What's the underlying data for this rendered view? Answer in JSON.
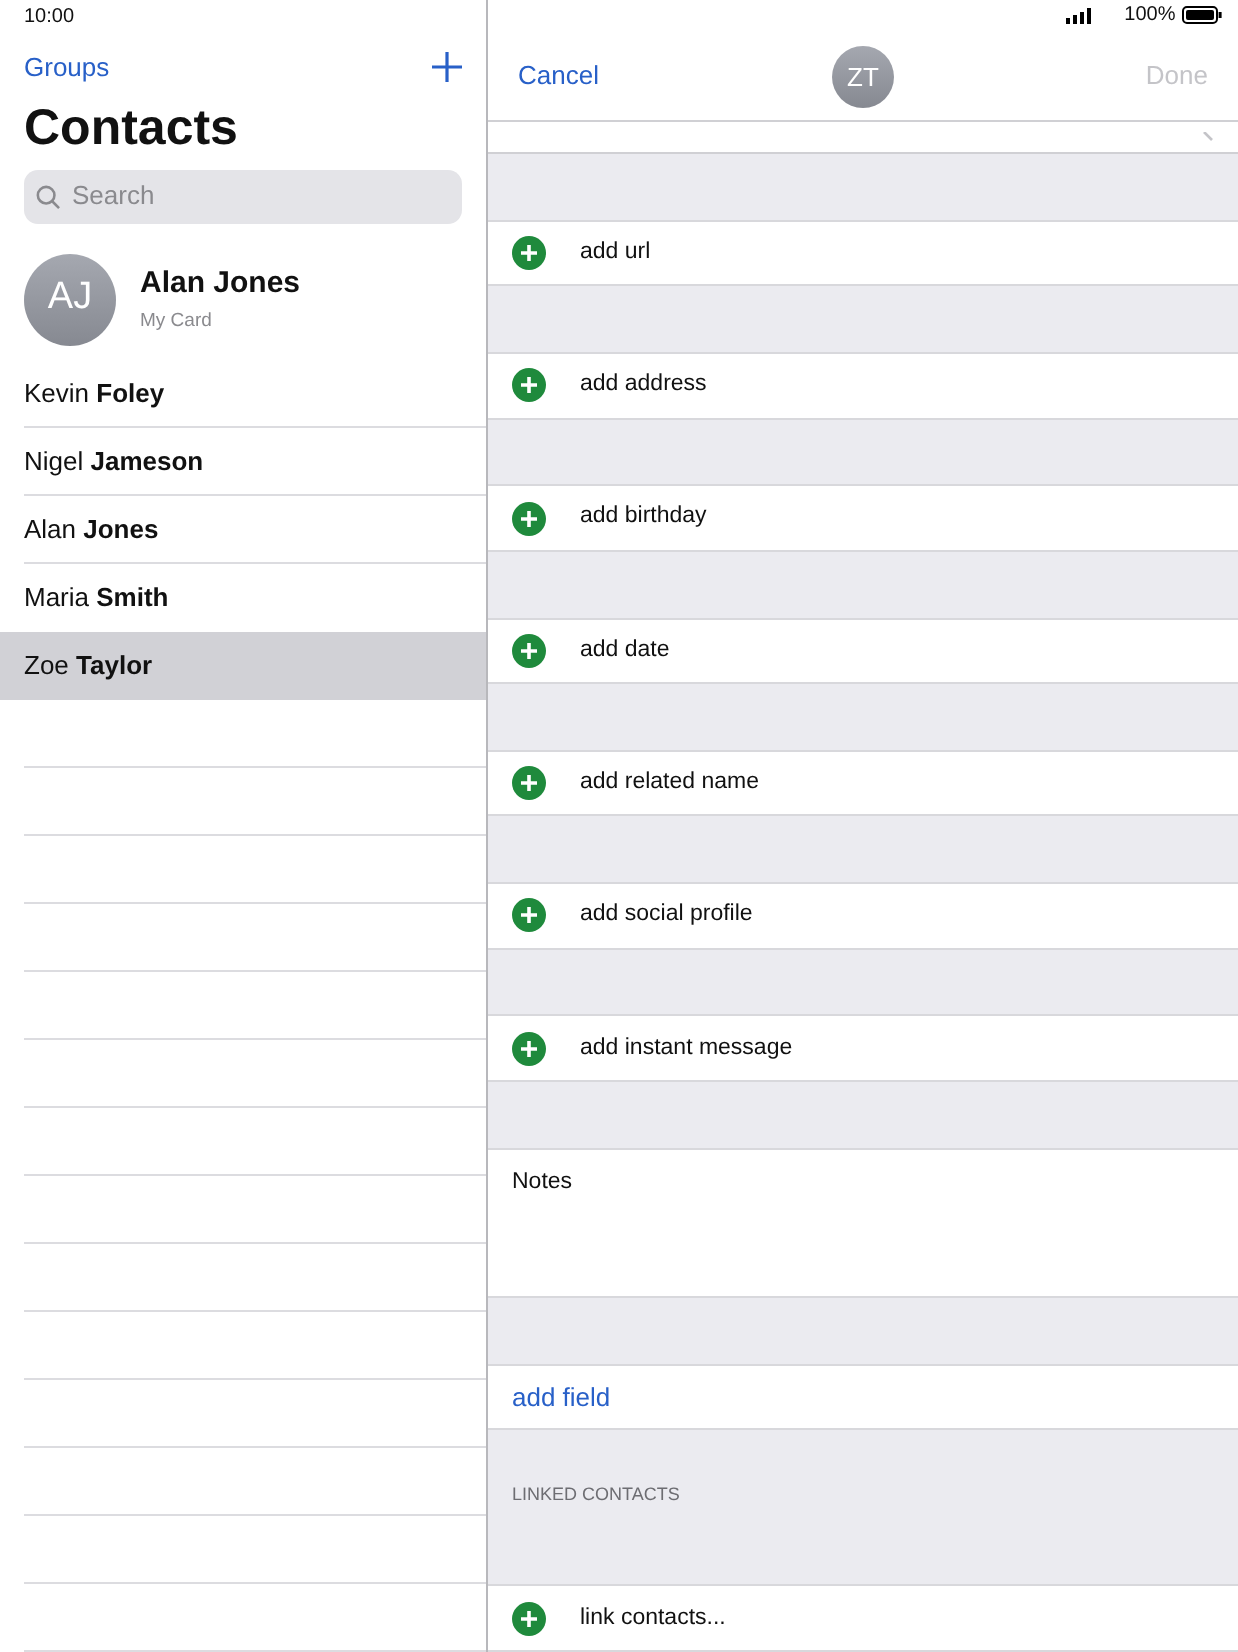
{
  "status_bar": {
    "time": "10:00",
    "battery": "100%"
  },
  "sidebar": {
    "groups_link": "Groups",
    "title": "Contacts",
    "search": {
      "placeholder": "Search"
    },
    "my_card": {
      "initials": "AJ",
      "name": "Alan Jones",
      "subtitle": "My Card"
    },
    "contacts": [
      {
        "first": "Kevin",
        "last": "Foley",
        "selected": false
      },
      {
        "first": "Nigel",
        "last": "Jameson",
        "selected": false
      },
      {
        "first": "Alan",
        "last": "Jones",
        "selected": false
      },
      {
        "first": "Maria",
        "last": "Smith",
        "selected": false
      },
      {
        "first": "Zoe",
        "last": "Taylor",
        "selected": true
      }
    ]
  },
  "editor": {
    "cancel": "Cancel",
    "initials": "ZT",
    "done": {
      "label": "Done",
      "disabled": true
    },
    "rows": [
      {
        "kind": "add",
        "label": "add url"
      },
      {
        "kind": "add",
        "label": "add address"
      },
      {
        "kind": "add",
        "label": "add birthday"
      },
      {
        "kind": "add",
        "label": "add date"
      },
      {
        "kind": "add",
        "label": "add related name"
      },
      {
        "kind": "add",
        "label": "add social profile"
      },
      {
        "kind": "add",
        "label": "add instant message"
      },
      {
        "kind": "notes",
        "label": "Notes"
      },
      {
        "kind": "link",
        "label": "add field"
      },
      {
        "kind": "section",
        "label": "LINKED CONTACTS"
      },
      {
        "kind": "add",
        "label": "link contacts..."
      }
    ]
  }
}
